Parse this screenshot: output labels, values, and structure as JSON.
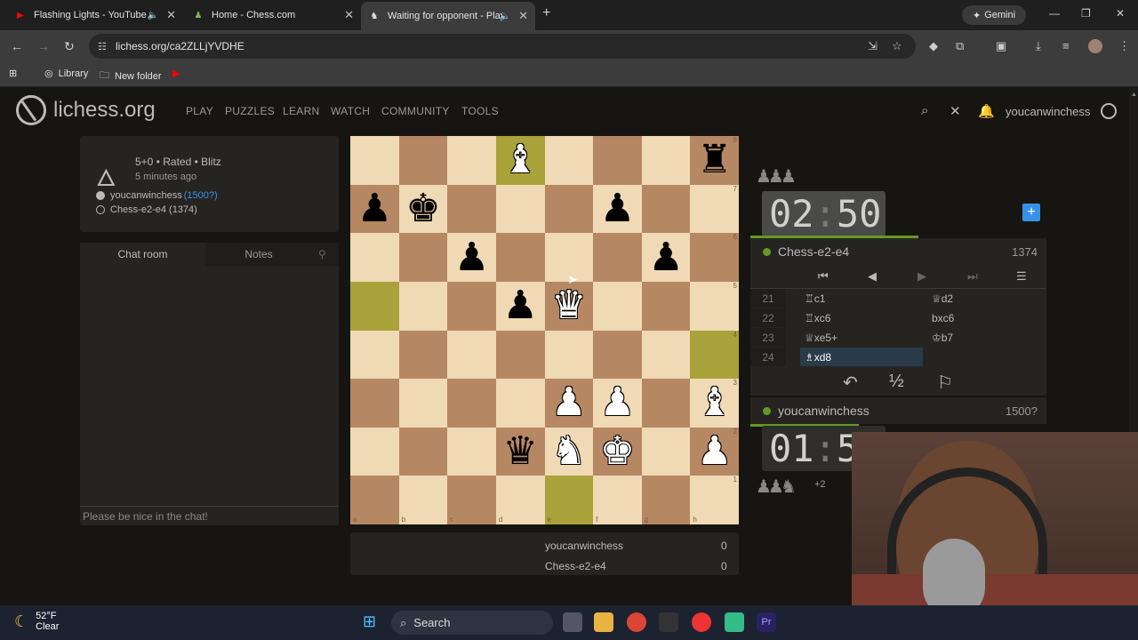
{
  "browser": {
    "tabs": [
      {
        "title": "Flashing Lights - YouTube",
        "icon": "youtube-icon"
      },
      {
        "title": "Home - Chess.com",
        "icon": "chesscom-icon"
      },
      {
        "title": "Waiting for opponent - Play",
        "icon": "lichess-icon",
        "active": true
      }
    ],
    "gemini": "Gemini",
    "url": "lichess.org/ca2ZLLjYVDHE",
    "bookmarks": [
      "Library",
      "New folder"
    ]
  },
  "header": {
    "logo": "lichess.org",
    "nav": [
      "PLAY",
      "PUZZLES",
      "LEARN",
      "WATCH",
      "COMMUNITY",
      "TOOLS"
    ],
    "username": "youcanwinchess"
  },
  "gameinfo": {
    "title": "5+0 • Rated • Blitz",
    "time_ago": "5 minutes ago",
    "white_name": "youcanwinchess",
    "white_rating": "(1500?)",
    "black": "Chess-e2-e4 (1374)"
  },
  "chat": {
    "tab_chat": "Chat room",
    "tab_notes": "Notes",
    "placeholder": "Please be nice in the chat!"
  },
  "board": {
    "rows": [
      [
        "",
        "",
        "",
        "wB",
        "",
        "",
        "",
        "bR"
      ],
      [
        "bP",
        "bK",
        "",
        "",
        "",
        "bP",
        "",
        ""
      ],
      [
        "",
        "",
        "bP",
        "",
        "",
        "",
        "bP",
        ""
      ],
      [
        "",
        "",
        "",
        "bP",
        "wQ",
        "",
        "",
        ""
      ],
      [
        "",
        "",
        "",
        "",
        "",
        "",
        "",
        ""
      ],
      [
        "",
        "",
        "",
        "",
        "wP",
        "wP",
        "",
        "wB"
      ],
      [
        "",
        "",
        "",
        "bQ",
        "wN",
        "wK",
        "",
        "wP"
      ],
      [
        "",
        "",
        "",
        "",
        "",
        "",
        "",
        ""
      ]
    ],
    "highlight": [
      "3,0",
      "4,7"
    ],
    "files": [
      "a",
      "b",
      "c",
      "d",
      "e",
      "f",
      "g",
      "h"
    ],
    "ranks": [
      "8",
      "7",
      "6",
      "5",
      "4",
      "3",
      "2",
      "1"
    ]
  },
  "score": {
    "p1": "youcanwinchess",
    "p1_score": "0",
    "p2": "Chess-e2-e4",
    "p2_score": "0"
  },
  "right": {
    "top_clock_min": "02",
    "top_clock_sec": "50",
    "top_player": "Chess-e2-e4",
    "top_rating": "1374",
    "bottom_clock_min": "01",
    "bottom_clock_sec": "51",
    "bottom_player": "youcanwinchess",
    "bottom_rating": "1500?",
    "material_diff": "+2",
    "moves": [
      {
        "n": "21",
        "w": "♖c1",
        "b": "♕d2"
      },
      {
        "n": "22",
        "w": "♖xc6",
        "b": "bxc6"
      },
      {
        "n": "23",
        "w": "♕xe5+",
        "b": "♔b7"
      },
      {
        "n": "24",
        "w": "♗xd8",
        "b": ""
      }
    ],
    "draw": "½"
  },
  "taskbar": {
    "temp": "52°F",
    "cond": "Clear",
    "search": "Search"
  }
}
